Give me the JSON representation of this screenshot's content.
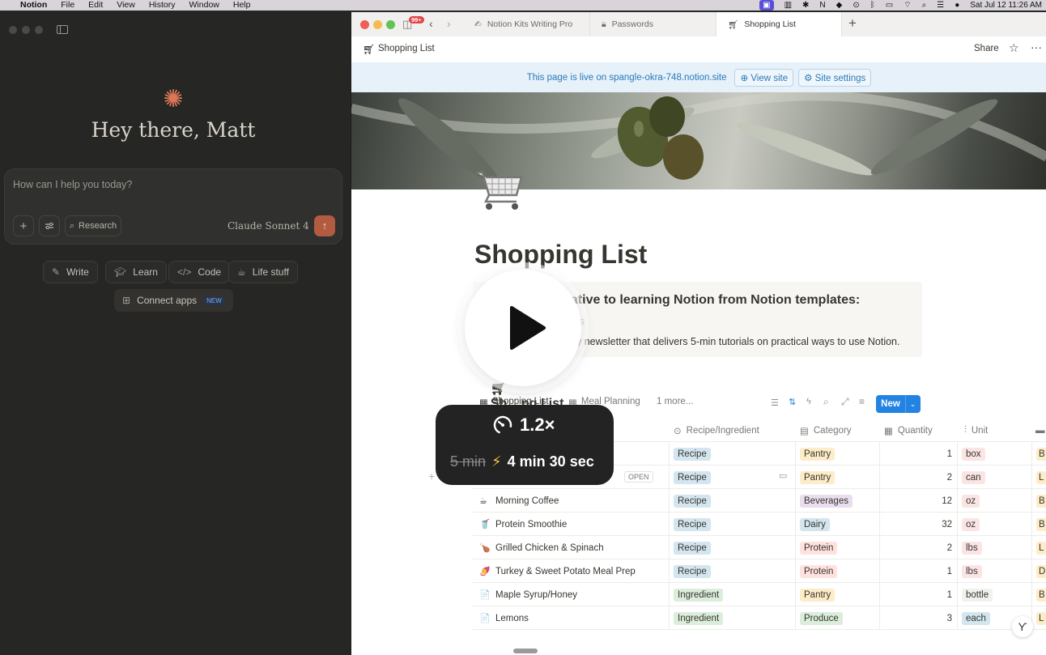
{
  "menubar": {
    "app": "Notion",
    "items": [
      "File",
      "Edit",
      "View",
      "History",
      "Window",
      "Help"
    ],
    "datetime": "Sat Jul 12  11:26 AM"
  },
  "claude": {
    "greeting": "Hey there, Matt",
    "placeholder": "How can I help you today?",
    "research_label": "Research",
    "model": "Claude Sonnet 4",
    "chips": [
      "Write",
      "Learn",
      "Code",
      "Life stuff"
    ],
    "connect_label": "Connect apps",
    "new_badge": "NEW"
  },
  "notion": {
    "badge": "99+",
    "tabs": [
      "Notion Kits Writing Pro",
      "Passwords",
      "Shopping List"
    ],
    "breadcrumb": "Shopping List",
    "share_label": "Share",
    "banner_text": "This page is live on spangle-okra-748.notion.site",
    "view_site": "View site",
    "site_settings": "Site settings",
    "page_title": "Shopping List",
    "callout_heading": "ernative to learning Notion from Notion templates:",
    "callout_line1": "ts",
    "callout_line2": "y newsletter that delivers 5-min tutorials on practical ways to use Notion.",
    "db_title": "Sh    ng List",
    "views": [
      "Shopping List",
      "Meal Planning",
      "1 more..."
    ],
    "new_button": "New",
    "columns": [
      "Recipe/Ingredient",
      "Category",
      "Quantity",
      "Unit"
    ],
    "open_label": "OPEN",
    "rows": [
      {
        "name": "",
        "type": "Recipe",
        "category": "Pantry",
        "qty": "1",
        "unit": "box",
        "cat_color": "#fdecc8",
        "unit_color": "#fbe4e4",
        "extra": "B"
      },
      {
        "name": "Bo",
        "type": "Recipe",
        "category": "Pantry",
        "qty": "2",
        "unit": "can",
        "cat_color": "#fdecc8",
        "unit_color": "#fbe4e4",
        "extra": "L"
      },
      {
        "name": "Morning Coffee",
        "type": "Recipe",
        "category": "Beverages",
        "qty": "12",
        "unit": "oz",
        "cat_color": "#e8deee",
        "unit_color": "#fbe4e4",
        "extra": "B"
      },
      {
        "name": "Protein Smoothie",
        "type": "Recipe",
        "category": "Dairy",
        "qty": "32",
        "unit": "oz",
        "cat_color": "#d3e5ef",
        "unit_color": "#fbe4e4",
        "extra": "B"
      },
      {
        "name": "Grilled Chicken & Spinach",
        "type": "Recipe",
        "category": "Protein",
        "qty": "2",
        "unit": "lbs",
        "cat_color": "#ffe2dd",
        "unit_color": "#fbe4e4",
        "extra": "L"
      },
      {
        "name": "Turkey & Sweet Potato Meal Prep",
        "type": "Recipe",
        "category": "Protein",
        "qty": "1",
        "unit": "lbs",
        "cat_color": "#ffe2dd",
        "unit_color": "#fbe4e4",
        "extra": "D"
      },
      {
        "name": "Maple Syrup/Honey",
        "type": "Ingredient",
        "category": "Pantry",
        "qty": "1",
        "unit": "bottle",
        "cat_color": "#fdecc8",
        "unit_color": "#f1f1ef",
        "extra": "B"
      },
      {
        "name": "Lemons",
        "type": "Ingredient",
        "category": "Produce",
        "qty": "3",
        "unit": "each",
        "cat_color": "#dbeddb",
        "unit_color": "#d3e5ef",
        "extra": "L"
      }
    ],
    "row_icons": [
      "",
      "",
      "☕",
      "🥤",
      "🍗",
      "🍠",
      "📄",
      "📄"
    ]
  },
  "overlay": {
    "speed": "1.2×",
    "old_time": "5 min",
    "new_time": "4 min 30 sec"
  }
}
